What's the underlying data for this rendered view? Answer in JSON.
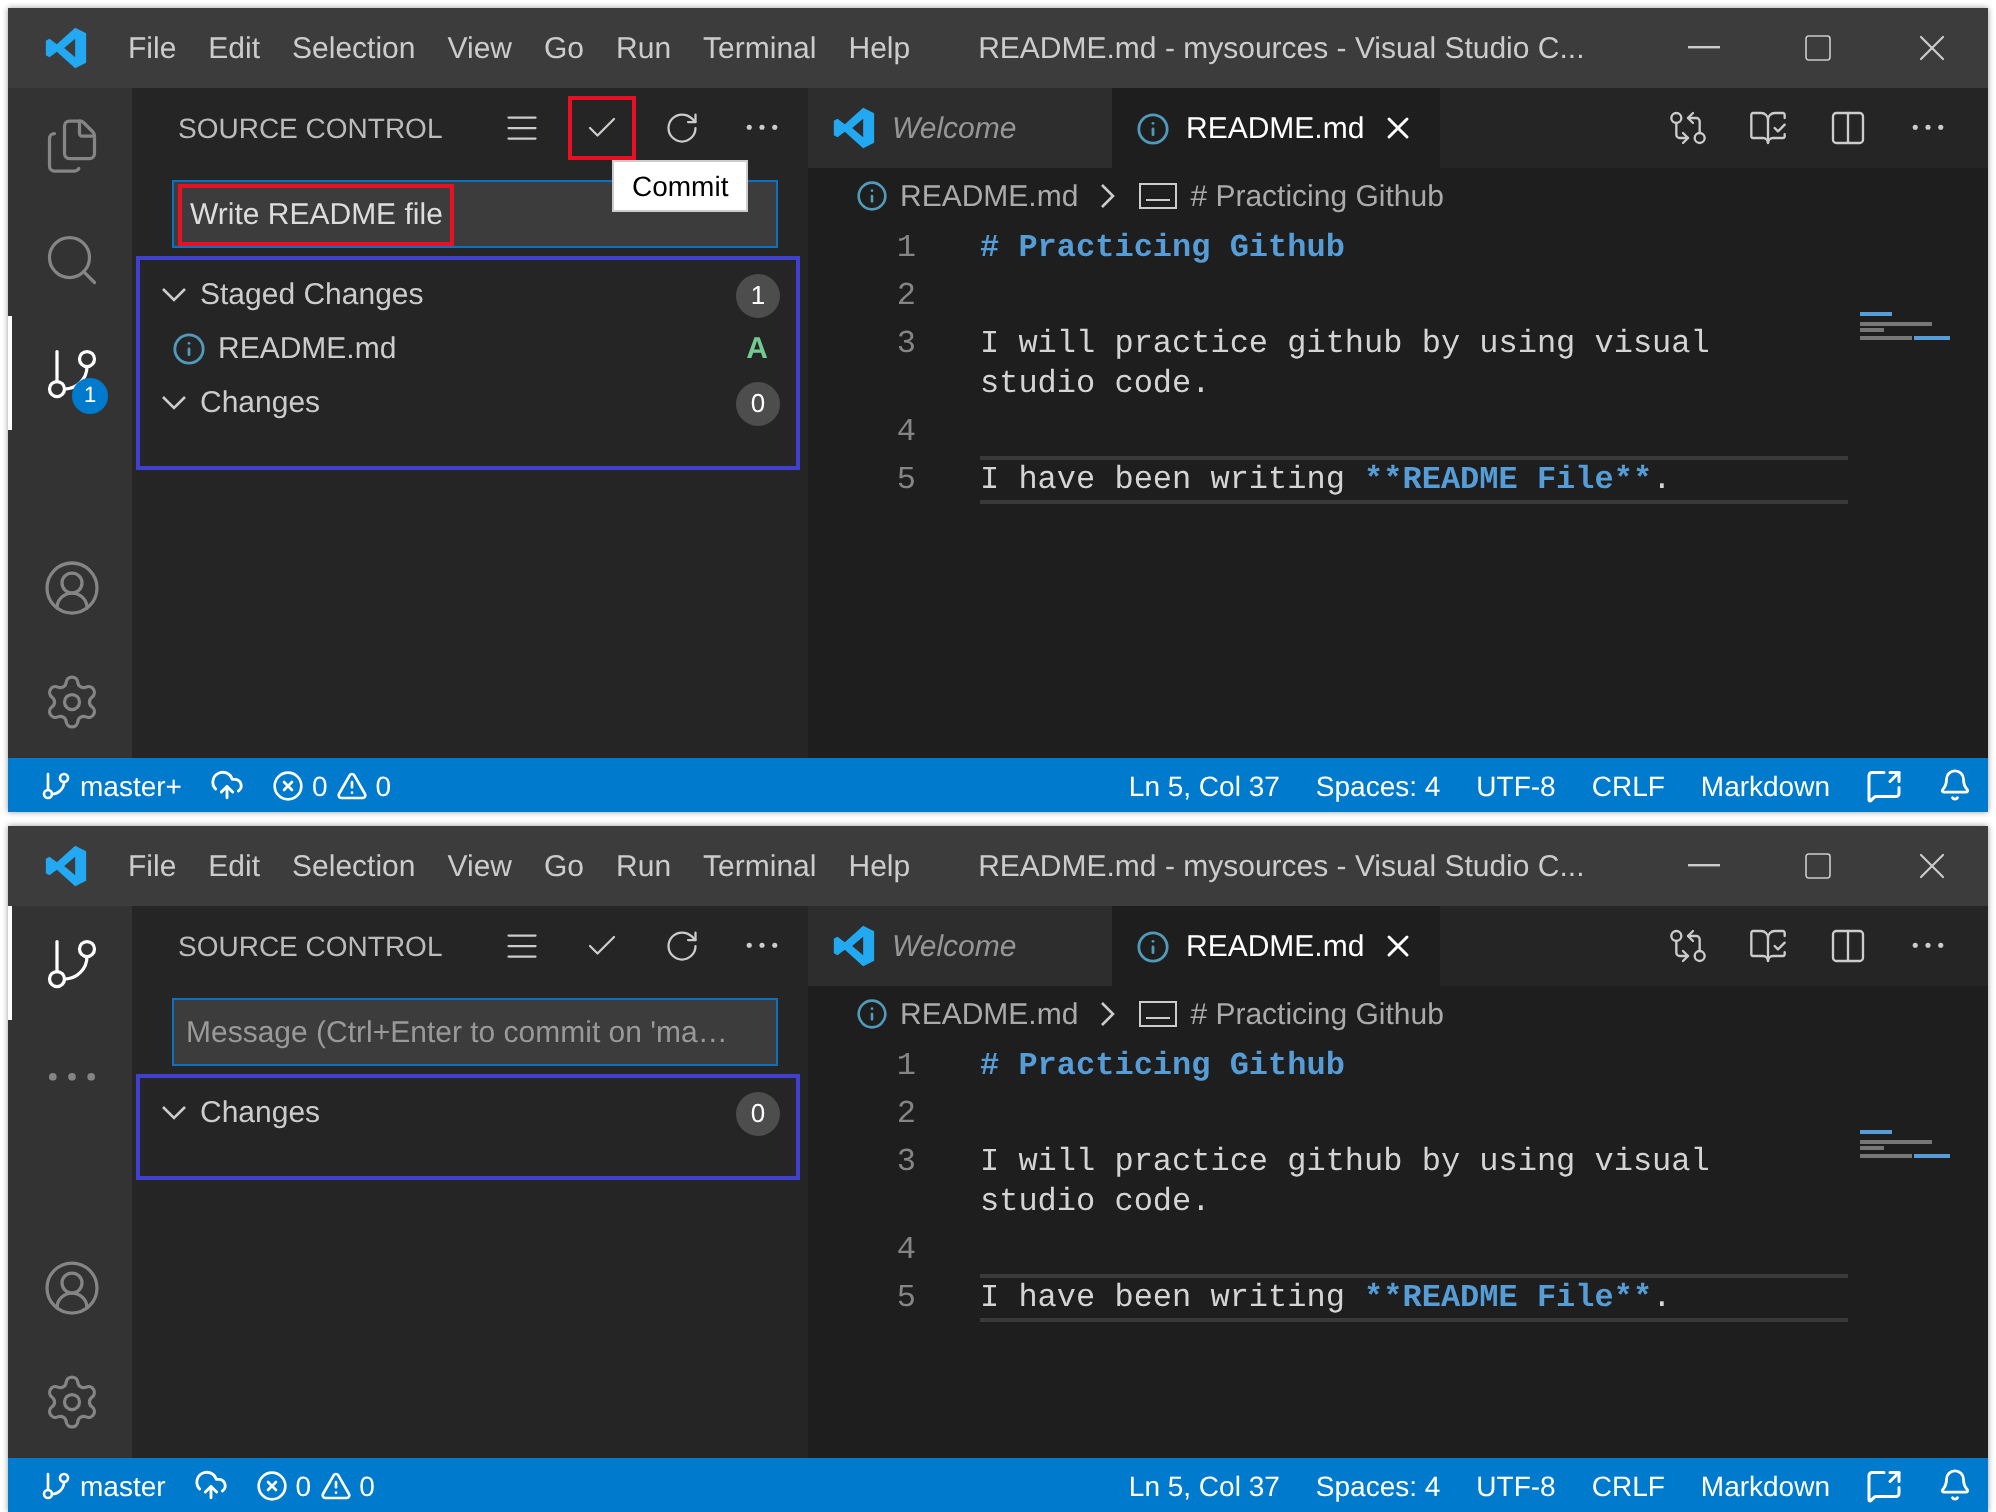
{
  "windows": [
    {
      "menu": [
        "File",
        "Edit",
        "Selection",
        "View",
        "Go",
        "Run",
        "Terminal",
        "Help"
      ],
      "title": "README.md - mysources - Visual Studio C...",
      "activity_bar": [
        {
          "kind": "files",
          "selected": false
        },
        {
          "kind": "search",
          "selected": false
        },
        {
          "kind": "scm",
          "selected": true,
          "badge": "1"
        },
        {
          "kind": "account",
          "selected": false
        },
        {
          "kind": "settings",
          "selected": false
        }
      ],
      "sidebar": {
        "title": "SOURCE CONTROL",
        "actions": [
          {
            "kind": "list",
            "highlighted": false
          },
          {
            "kind": "commit",
            "highlighted": true
          },
          {
            "kind": "refresh",
            "highlighted": false
          },
          {
            "kind": "more",
            "highlighted": false
          }
        ],
        "tooltip": "Commit",
        "message": {
          "value": "Write README file",
          "highlighted": true
        },
        "groups_outlined": true,
        "groups": [
          {
            "label": "Staged Changes",
            "count": "1",
            "expanded": true,
            "files": [
              {
                "name": "README.md",
                "status": "A"
              }
            ]
          },
          {
            "label": "Changes",
            "count": "0",
            "expanded": true
          }
        ]
      },
      "tabs": [
        {
          "label": "Welcome",
          "kind": "welcome",
          "selected": false
        },
        {
          "label": "README.md",
          "kind": "markdown",
          "selected": true
        }
      ],
      "breadcrumb": [
        "README.md",
        "# Practicing Github"
      ],
      "lines": [
        {
          "number": "1",
          "current": false,
          "segments": [
            {
              "text": "# Practicing Github",
              "kind": "heading"
            }
          ]
        },
        {
          "number": "2",
          "current": false
        },
        {
          "number": "3",
          "current": false,
          "segments": [
            {
              "text": "I will practice github by using visual studio code.",
              "kind": "plain"
            }
          ]
        },
        {
          "number": "4",
          "current": false
        },
        {
          "number": "5",
          "current": true,
          "segments": [
            {
              "text": "I have been writing ",
              "kind": "plain"
            },
            {
              "text": "**README File**",
              "kind": "strong"
            },
            {
              "text": ".",
              "kind": "plain"
            }
          ]
        }
      ],
      "status": {
        "branch": "master+",
        "errors": "0",
        "warnings": "0",
        "items": [
          "Ln 5, Col 37",
          "Spaces: 4",
          "UTF-8",
          "CRLF",
          "Markdown"
        ]
      }
    },
    {
      "menu": [
        "File",
        "Edit",
        "Selection",
        "View",
        "Go",
        "Run",
        "Terminal",
        "Help"
      ],
      "title": "README.md - mysources - Visual Studio C...",
      "activity_bar": [
        {
          "kind": "scm",
          "selected": true
        },
        {
          "kind": "more",
          "selected": false
        },
        {
          "kind": "account",
          "selected": false
        },
        {
          "kind": "settings",
          "selected": false
        }
      ],
      "sidebar": {
        "title": "SOURCE CONTROL",
        "actions": [
          {
            "kind": "list",
            "highlighted": false
          },
          {
            "kind": "commit",
            "highlighted": false
          },
          {
            "kind": "refresh",
            "highlighted": false
          },
          {
            "kind": "more",
            "highlighted": false
          }
        ],
        "message": {
          "placeholder": "Message (Ctrl+Enter to commit on 'ma…",
          "highlighted": false
        },
        "groups_outlined": true,
        "groups": [
          {
            "label": "Changes",
            "count": "0",
            "expanded": true
          }
        ]
      },
      "tabs": [
        {
          "label": "Welcome",
          "kind": "welcome",
          "selected": false
        },
        {
          "label": "README.md",
          "kind": "markdown",
          "selected": true
        }
      ],
      "breadcrumb": [
        "README.md",
        "# Practicing Github"
      ],
      "lines": [
        {
          "number": "1",
          "current": false,
          "segments": [
            {
              "text": "# Practicing Github",
              "kind": "heading"
            }
          ]
        },
        {
          "number": "2",
          "current": false
        },
        {
          "number": "3",
          "current": false,
          "segments": [
            {
              "text": "I will practice github by using visual studio code.",
              "kind": "plain"
            }
          ]
        },
        {
          "number": "4",
          "current": false
        },
        {
          "number": "5",
          "current": true,
          "segments": [
            {
              "text": "I have been writing ",
              "kind": "plain"
            },
            {
              "text": "**README File**",
              "kind": "strong"
            },
            {
              "text": ".",
              "kind": "plain"
            }
          ]
        }
      ],
      "status": {
        "branch": "master",
        "errors": "0",
        "warnings": "0",
        "items": [
          "Ln 5, Col 37",
          "Spaces: 4",
          "UTF-8",
          "CRLF",
          "Markdown"
        ]
      }
    }
  ]
}
